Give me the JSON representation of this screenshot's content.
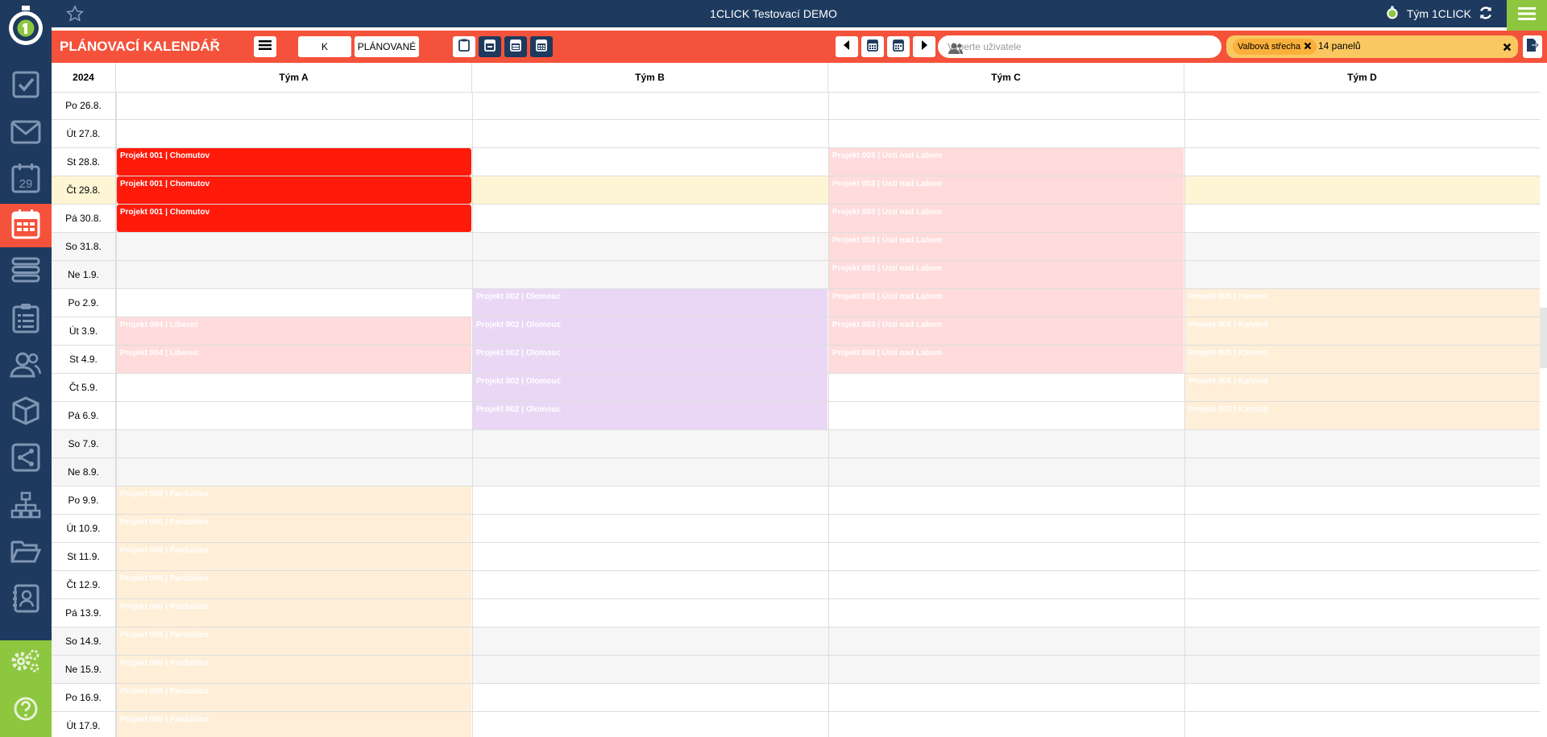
{
  "app": {
    "title": "1CLICK Testovací DEMO",
    "team_label": "Tým 1CLICK"
  },
  "sidebar": {
    "items": [
      {
        "icon": "checkbox-icon"
      },
      {
        "icon": "mail-icon"
      },
      {
        "icon": "calendar-day-icon",
        "day": "29"
      },
      {
        "icon": "planning-calendar-icon",
        "active": true
      },
      {
        "icon": "layers-icon"
      },
      {
        "icon": "clipboard-list-icon"
      },
      {
        "icon": "users-icon"
      },
      {
        "icon": "box-icon"
      },
      {
        "icon": "share-icon"
      },
      {
        "icon": "org-chart-icon"
      },
      {
        "icon": "folder-open-icon"
      },
      {
        "icon": "contact-book-icon"
      }
    ],
    "bottom": [
      {
        "icon": "settings-icon"
      },
      {
        "icon": "help-icon"
      }
    ]
  },
  "toolbar": {
    "title": "PLÁNOVACÍ KALENDÁŘ",
    "k_realizaci": "K REALIZACI",
    "planovane": "PLÁNOVANÉ",
    "user_placeholder": "Vyberte uživatele",
    "filter_chip": "Valbová střecha",
    "filter_count": "14 panelů"
  },
  "colors": {
    "navy": "#1e3a5f",
    "red": "#f4523b",
    "green": "#8dc63f",
    "project001": "#ff1a0a",
    "project003": "#ffdbdb",
    "project002": "#ead7f5",
    "project004": "#ffdbdb",
    "project005": "#ffefd8",
    "project006": "#ffefd8"
  },
  "calendar": {
    "year": "2024",
    "teams": [
      "Tým A",
      "Tým B",
      "Tým C",
      "Tým D"
    ],
    "days": [
      {
        "label": "Po 26.8."
      },
      {
        "label": "Út 27.8."
      },
      {
        "label": "St 28.8."
      },
      {
        "label": "Čt 29.8.",
        "today": true
      },
      {
        "label": "Pá 30.8."
      },
      {
        "label": "So 31.8.",
        "weekend": true
      },
      {
        "label": "Ne 1.9.",
        "weekend": true
      },
      {
        "label": "Po 2.9."
      },
      {
        "label": "Út 3.9."
      },
      {
        "label": "St 4.9."
      },
      {
        "label": "Čt 5.9."
      },
      {
        "label": "Pá 6.9."
      },
      {
        "label": "So 7.9.",
        "weekend": true
      },
      {
        "label": "Ne 8.9.",
        "weekend": true
      },
      {
        "label": "Po 9.9."
      },
      {
        "label": "Út 10.9."
      },
      {
        "label": "St 11.9."
      },
      {
        "label": "Čt 12.9."
      },
      {
        "label": "Pá 13.9."
      },
      {
        "label": "So 14.9.",
        "weekend": true
      },
      {
        "label": "Ne 15.9.",
        "weekend": true
      },
      {
        "label": "Po 16.9."
      },
      {
        "label": "Út 17.9."
      }
    ],
    "projects": [
      {
        "label": "Projekt 001 | Chomutov",
        "team": 0,
        "from": 2,
        "to": 4,
        "color": "#ff1a0a",
        "text": "#ffffff"
      },
      {
        "label": "Projekt 003 | Ústí nad Labem",
        "team": 2,
        "from": 2,
        "to": 9,
        "color": "#ffdbdb",
        "text": "#ffffff"
      },
      {
        "label": "Projekt 002 | Olomouc",
        "team": 1,
        "from": 7,
        "to": 11,
        "color": "#ead7f5",
        "text": "#ffffff"
      },
      {
        "label": "Projekt 005 | Karviná",
        "team": 3,
        "from": 7,
        "to": 11,
        "color": "#ffefd8",
        "text": "#ffffff"
      },
      {
        "label": "Projekt 004 | Liberec",
        "team": 0,
        "from": 8,
        "to": 9,
        "color": "#ffdbdb",
        "text": "#ffffff"
      },
      {
        "label": "Projekt 006 | Pardubice",
        "team": 0,
        "from": 14,
        "to": 22,
        "color": "#ffefd8",
        "text": "#ffffff"
      }
    ]
  }
}
